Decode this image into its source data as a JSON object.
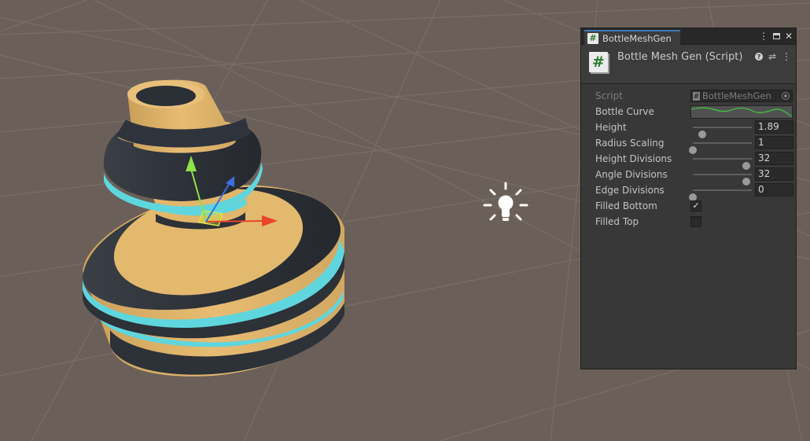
{
  "tab": {
    "title": "BottleMeshGen",
    "icon": "csharp-script-icon"
  },
  "window_controls": {
    "menu": "⋮",
    "close": "✕"
  },
  "component": {
    "title": "Bottle Mesh Gen (Script)",
    "icon": "csharp-script-icon",
    "help_icon": "help-icon",
    "presets_icon": "sliders-icon",
    "menu": "⋮"
  },
  "properties": {
    "script": {
      "label": "Script",
      "value": "BottleMeshGen"
    },
    "bottle_curve": {
      "label": "Bottle Curve"
    },
    "height": {
      "label": "Height",
      "value": "1.89",
      "fraction": 0.16
    },
    "radius_scaling": {
      "label": "Radius Scaling",
      "value": "1",
      "fraction": 0.0
    },
    "height_divisions": {
      "label": "Height Divisions",
      "value": "32",
      "fraction": 0.9
    },
    "angle_divisions": {
      "label": "Angle Divisions",
      "value": "32",
      "fraction": 0.9
    },
    "edge_divisions": {
      "label": "Edge Divisions",
      "value": "0",
      "fraction": 0.0
    },
    "filled_bottom": {
      "label": "Filled Bottom",
      "checked": true,
      "mark": "✓"
    },
    "filled_top": {
      "label": "Filled Top",
      "checked": false
    }
  },
  "colors": {
    "viewport_bg": "#6b6059",
    "bottle_tan": "#e2b66b",
    "bottle_dark": "#2f343c",
    "bottle_cyan": "#5fd6de",
    "axis_x": "#e8442b",
    "axis_y": "#8fe04a",
    "axis_z": "#3a6fe0",
    "curve_green": "#3ecf3e"
  },
  "scene": {
    "light_icon": "light-bulb-icon",
    "gizmo_icon": "transform-gizmo-icon"
  }
}
